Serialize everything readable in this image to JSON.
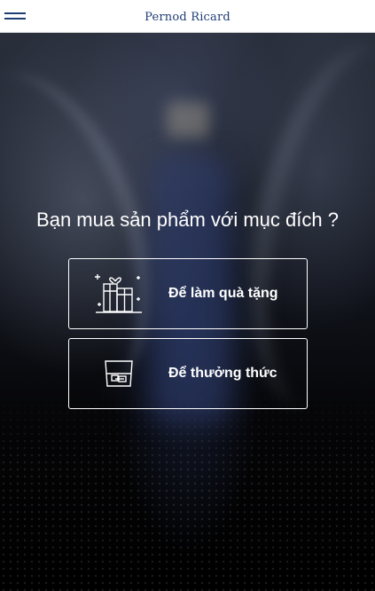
{
  "header": {
    "brand": "Pernod Ricard",
    "menu_icon": "hamburger-menu-icon"
  },
  "main": {
    "question": "Bạn mua sản phẩm với mục đích ?",
    "options": [
      {
        "label": "Để làm quà tặng",
        "icon": "gift-boxes-icon"
      },
      {
        "label": "Để thưởng thức",
        "icon": "glass-icon"
      }
    ]
  },
  "colors": {
    "brand_navy": "#1f3d75",
    "header_bg": "#ffffff",
    "option_border": "#ffffff",
    "text": "#ffffff"
  }
}
